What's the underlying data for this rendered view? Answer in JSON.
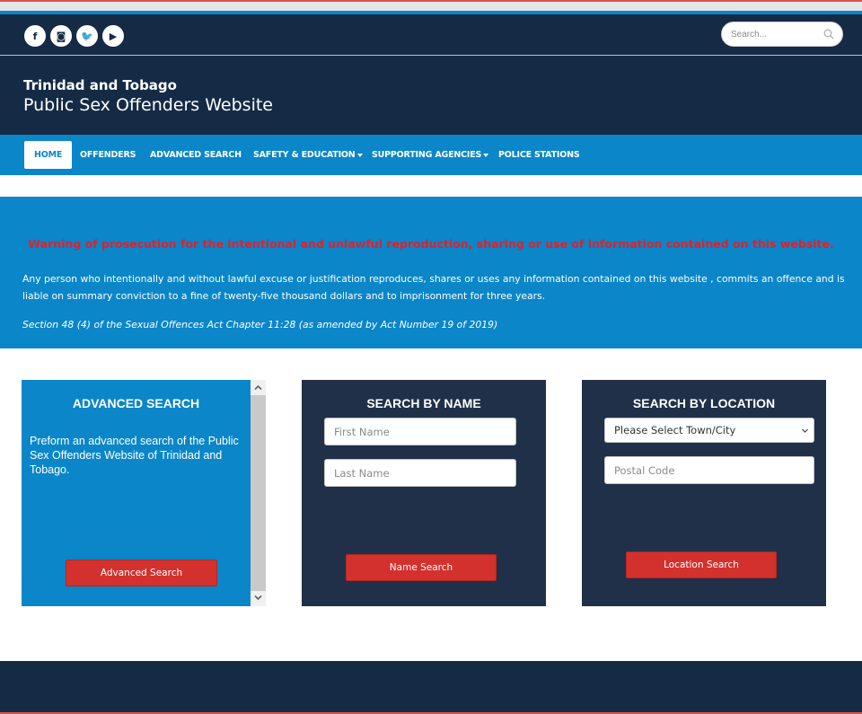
{
  "topbar": {
    "socials": [
      {
        "icon": "facebook-icon",
        "glyph": "f"
      },
      {
        "icon": "instagram-icon",
        "glyph": "◙"
      },
      {
        "icon": "twitter-icon",
        "glyph": "🐦"
      },
      {
        "icon": "youtube-icon",
        "glyph": "▶"
      }
    ],
    "search_placeholder": "Search..."
  },
  "header": {
    "line1": "Trinidad and Tobago",
    "line2": "Public Sex Offenders Website"
  },
  "nav": {
    "items": [
      {
        "label": "HOME",
        "active": true
      },
      {
        "label": "OFFENDERS"
      },
      {
        "label": "ADVANCED SEARCH"
      },
      {
        "label": "SAFETY & EDUCATION",
        "dropdown": true
      },
      {
        "label": "SUPPORTING AGENCIES",
        "dropdown": true
      },
      {
        "label": "POLICE STATIONS"
      }
    ]
  },
  "warning": {
    "title": "Warning of prosecution for the intentional and unlawful reproduction, sharing or use of information contained on this website.",
    "body": "Any person who intentionally and without lawful excuse or justification reproduces, shares or uses any information contained on this website , commits an offence and is liable on summary conviction to a fine of twenty-five thousand dollars and to imprisonment for three years.",
    "section": "Section 48 (4) of the Sexual Offences Act Chapter 11:28 (as amended by Act Number 19 of 2019)"
  },
  "advanced": {
    "title": "ADVANCED SEARCH",
    "description": "Preform an advanced search of the Public Sex Offenders Website of Trinidad and Tobago.",
    "button": "Advanced Search"
  },
  "by_name": {
    "title": "SEARCH BY NAME",
    "first_placeholder": "First Name",
    "last_placeholder": "Last Name",
    "button": "Name Search"
  },
  "by_location": {
    "title": "SEARCH BY LOCATION",
    "select_value": "Please Select Town/City",
    "postal_placeholder": "Postal Code",
    "button": "Location Search"
  },
  "colors": {
    "navy": "#152a45",
    "blue": "#0a86c9",
    "red": "#d3312d"
  }
}
